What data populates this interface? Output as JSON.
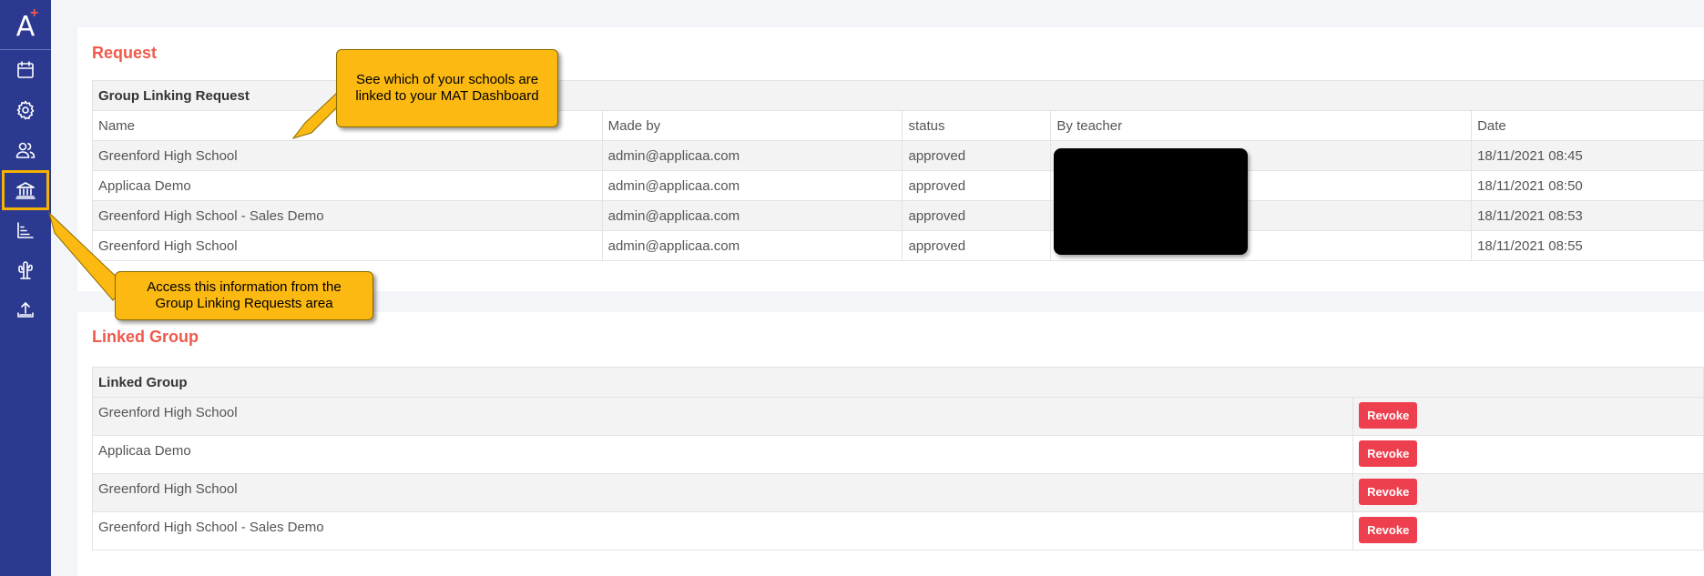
{
  "logo": {
    "letter": "A",
    "plus": "+"
  },
  "sidebar": {
    "items": [
      {
        "name": "calendar-icon"
      },
      {
        "name": "gear-icon"
      },
      {
        "name": "users-icon"
      },
      {
        "name": "institution-icon",
        "active": true
      },
      {
        "name": "bar-chart-icon"
      },
      {
        "name": "cactus-icon"
      },
      {
        "name": "upload-icon"
      }
    ]
  },
  "request": {
    "title": "Request",
    "table_title": "Group Linking Request",
    "columns": [
      "Name",
      "Made by",
      "status",
      "By teacher",
      "Date"
    ],
    "rows": [
      {
        "name": "Greenford High School",
        "made_by": "admin@applicaa.com",
        "status": "approved",
        "teacher": "",
        "date": "18/11/2021 08:45"
      },
      {
        "name": "Applicaa Demo",
        "made_by": "admin@applicaa.com",
        "status": "approved",
        "teacher": "",
        "date": "18/11/2021 08:50"
      },
      {
        "name": "Greenford High School - Sales Demo",
        "made_by": "admin@applicaa.com",
        "status": "approved",
        "teacher": "",
        "date": "18/11/2021 08:53"
      },
      {
        "name": "Greenford High School",
        "made_by": "admin@applicaa.com",
        "status": "approved",
        "teacher": "",
        "date": "18/11/2021 08:55"
      }
    ]
  },
  "linked": {
    "title": "Linked Group",
    "table_title": "Linked Group",
    "revoke_label": "Revoke",
    "rows": [
      {
        "name": "Greenford High School"
      },
      {
        "name": "Applicaa Demo"
      },
      {
        "name": "Greenford High School"
      },
      {
        "name": "Greenford High School - Sales Demo"
      }
    ]
  },
  "callouts": {
    "schools_linked": "See which of your schools are linked to your MAT Dashboard",
    "access_info": "Access this information from the Group Linking Requests area"
  },
  "colors": {
    "sidebar": "#2b3990",
    "accent": "#ef5a4c",
    "revoke": "#ee3f4e",
    "callout": "#fcb912",
    "highlight": "#f5b200"
  }
}
